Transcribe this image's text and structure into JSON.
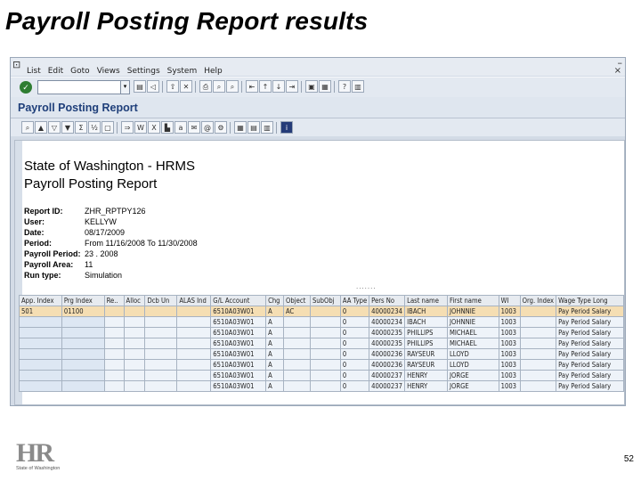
{
  "slide": {
    "title": "Payroll Posting Report results",
    "page_number": "52"
  },
  "sap": {
    "menu": [
      "List",
      "Edit",
      "Goto",
      "Views",
      "Settings",
      "System",
      "Help"
    ],
    "transaction_title": "Payroll Posting Report"
  },
  "report": {
    "title_line1": "State of Washington - HRMS",
    "title_line2": "Payroll Posting Report",
    "header": [
      {
        "label": "Report ID:",
        "value": "ZHR_RPTPY126"
      },
      {
        "label": "User:",
        "value": "KELLYW"
      },
      {
        "label": "Date:",
        "value": "08/17/2009"
      },
      {
        "label": "Period:",
        "value": "From 11/16/2008 To 11/30/2008"
      },
      {
        "label": "Payroll Period:",
        "value": "23 . 2008"
      },
      {
        "label": "Payroll Area:",
        "value": "11"
      },
      {
        "label": "Run type:",
        "value": "Simulation"
      }
    ],
    "separator": "......."
  },
  "table": {
    "columns": [
      "App. Index",
      "Prg Index",
      "Re..",
      "Alloc",
      "Dcb Un",
      "ALAS Ind",
      "G/L Account",
      "Chg",
      "Object",
      "SubObj",
      "AA Type",
      "Pers No",
      "Last name",
      "First name",
      "WI",
      "Org. Index",
      "Wage Type Long"
    ],
    "rows": [
      [
        "501",
        "01100",
        "",
        "",
        "",
        "",
        "6510A03W01",
        "A",
        "AC",
        "",
        "0",
        "40000234",
        "IBACH",
        "JOHNNIE",
        "1003",
        "",
        "Pay Period Salary"
      ],
      [
        "",
        "",
        "",
        "",
        "",
        "",
        "6510A03W01",
        "A",
        "",
        "",
        "0",
        "40000234",
        "IBACH",
        "JOHNNIE",
        "1003",
        "",
        "Pay Period Salary"
      ],
      [
        "",
        "",
        "",
        "",
        "",
        "",
        "6510A03W01",
        "A",
        "",
        "",
        "0",
        "40000235",
        "PHILLIPS",
        "MICHAEL",
        "1003",
        "",
        "Pay Period Salary"
      ],
      [
        "",
        "",
        "",
        "",
        "",
        "",
        "6510A03W01",
        "A",
        "",
        "",
        "0",
        "40000235",
        "PHILLIPS",
        "MICHAEL",
        "1003",
        "",
        "Pay Period Salary"
      ],
      [
        "",
        "",
        "",
        "",
        "",
        "",
        "6510A03W01",
        "A",
        "",
        "",
        "0",
        "40000236",
        "RAYSEUR",
        "LLOYD",
        "1003",
        "",
        "Pay Period Salary"
      ],
      [
        "",
        "",
        "",
        "",
        "",
        "",
        "6510A03W01",
        "A",
        "",
        "",
        "0",
        "40000236",
        "RAYSEUR",
        "LLOYD",
        "1003",
        "",
        "Pay Period Salary"
      ],
      [
        "",
        "",
        "",
        "",
        "",
        "",
        "6510A03W01",
        "A",
        "",
        "",
        "0",
        "40000237",
        "HENRY",
        "JORGE",
        "1003",
        "",
        "Pay Period Salary"
      ],
      [
        "",
        "",
        "",
        "",
        "",
        "",
        "6510A03W01",
        "A",
        "",
        "",
        "0",
        "40000237",
        "HENRY",
        "JORGE",
        "1003",
        "",
        "Pay Period Salary"
      ]
    ]
  },
  "logo": {
    "letters": "HR",
    "tagline": "State of Washington"
  },
  "icons": {
    "toolbar": [
      "enter-icon",
      "back-icon",
      "exit-icon",
      "cancel-icon",
      "save-icon",
      "print-icon",
      "find-icon",
      "find-next-icon",
      "first-page-icon",
      "prev-page-icon",
      "next-page-icon",
      "last-page-icon",
      "new-session-icon",
      "shortcut-icon",
      "help-icon",
      "layout-icon"
    ],
    "app_toolbar": [
      "details-icon",
      "sort-ascending-icon",
      "filter-icon",
      "sort-descending-icon",
      "totals-icon",
      "subtotals-icon",
      "print-preview-icon",
      "export-icon",
      "word-icon",
      "excel-icon",
      "graphic-icon",
      "abc-analysis-icon",
      "change-layout-icon",
      "select-layout-icon",
      "save-layout-icon",
      "information-icon"
    ]
  },
  "colors": {
    "title_blue": "#1f3f7a",
    "selected_row": "#f5deb3"
  }
}
